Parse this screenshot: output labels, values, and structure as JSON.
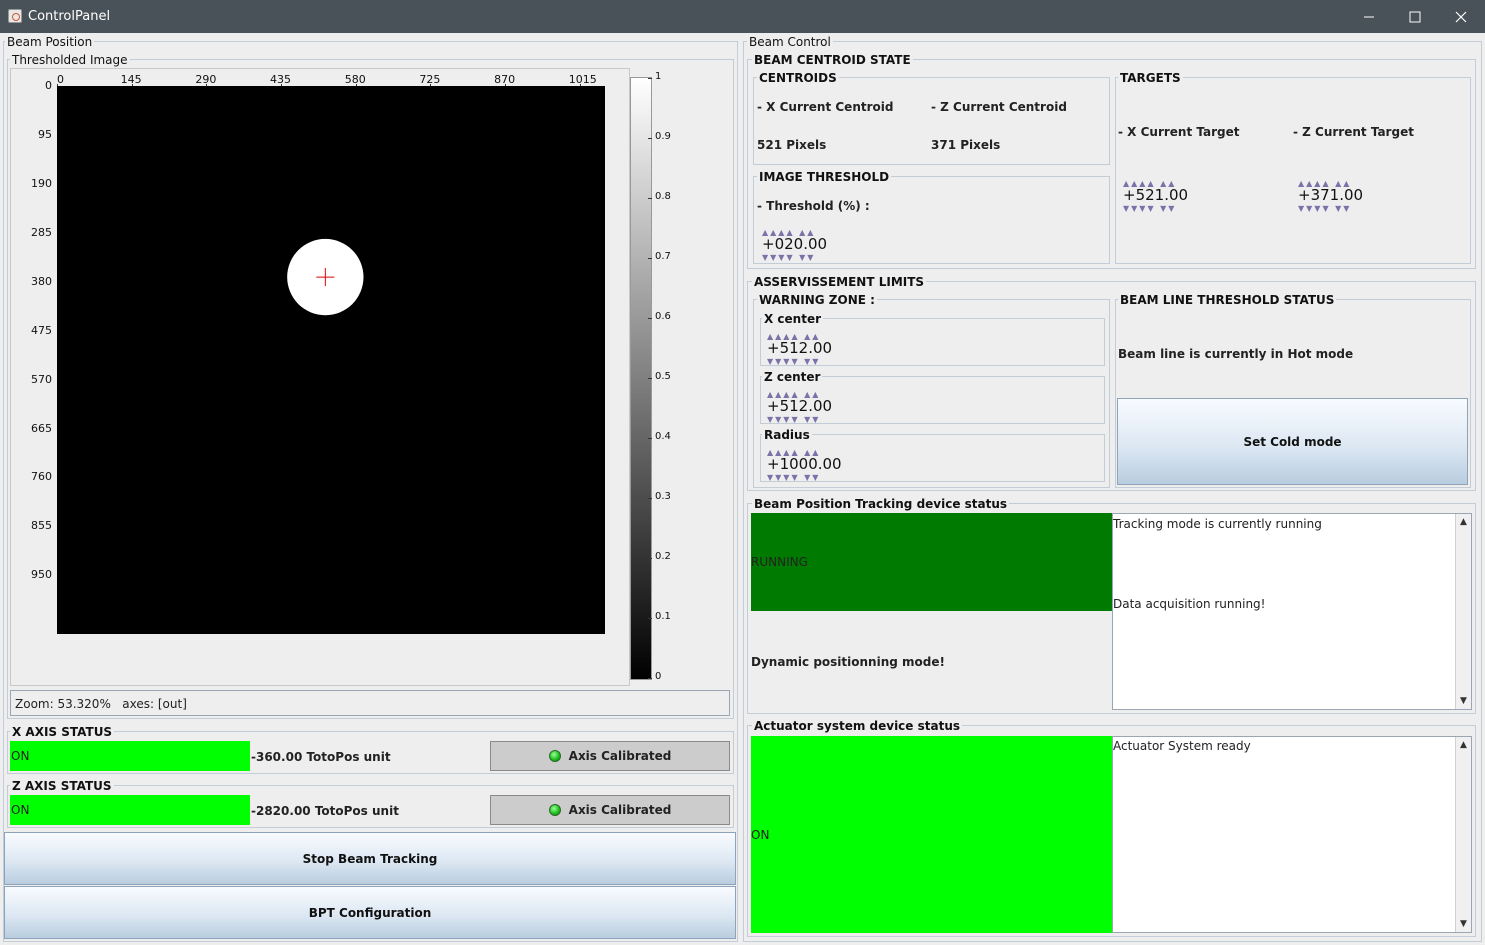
{
  "window": {
    "title": "ControlPanel",
    "minimize": "—",
    "maximize": "☐",
    "close": "✕"
  },
  "left": {
    "title": "Beam Position",
    "image_panel": {
      "title": "Thresholded Image",
      "x_ticks": [
        "0",
        "145",
        "290",
        "435",
        "580",
        "725",
        "870",
        "1015"
      ],
      "y_ticks": [
        "0",
        "95",
        "190",
        "285",
        "380",
        "475",
        "570",
        "665",
        "760",
        "855",
        "950"
      ],
      "colorbar_ticks": [
        "1",
        "0.9",
        "0.8",
        "0.7",
        "0.6",
        "0.5",
        "0.4",
        "0.3",
        "0.2",
        "0.1",
        "0"
      ],
      "beam_spot": {
        "x": 521,
        "y": 371,
        "radius": 95
      },
      "zoom_text": "Zoom: 53.320%   axes: [out]"
    },
    "x_axis": {
      "title": "X AXIS STATUS",
      "state": "ON",
      "position": "-360.00 TotoPos unit",
      "calibrated_label": "Axis Calibrated"
    },
    "z_axis": {
      "title": "Z AXIS STATUS",
      "state": "ON",
      "position": "-2820.00 TotoPos unit",
      "calibrated_label": "Axis Calibrated"
    },
    "stop_button": "Stop Beam Tracking",
    "config_button": "BPT Configuration"
  },
  "right": {
    "title": "Beam Control",
    "centroid_state": {
      "title": "BEAM CENTROID STATE",
      "centroids": {
        "title": "CENTROIDS",
        "x_label": "- X Current Centroid",
        "z_label": "- Z Current Centroid",
        "x_value": "521 Pixels",
        "z_value": "371 Pixels"
      },
      "threshold": {
        "title": "IMAGE THRESHOLD",
        "label": "- Threshold (%) :",
        "value": "+020.00"
      },
      "targets": {
        "title": "TARGETS",
        "x_label": "- X Current Target",
        "z_label": "- Z Current Target",
        "x_value": "+521.00",
        "z_value": "+371.00"
      }
    },
    "limits": {
      "title": "ASSERVISSEMENT LIMITS",
      "warning": {
        "title": "WARNING ZONE :",
        "x_center_label": "X center",
        "x_center_value": "+512.00",
        "z_center_label": "Z center",
        "z_center_value": "+512.00",
        "radius_label": "Radius",
        "radius_value": "+1000.00"
      },
      "beamline": {
        "title": "BEAM LINE THRESHOLD STATUS",
        "status_text": "Beam line is currently in Hot mode",
        "button": "Set Cold mode"
      }
    },
    "tracking": {
      "title": "Beam Position Tracking device status",
      "state": "RUNNING",
      "mode": "Dynamic positionning mode!",
      "log": [
        "Tracking mode is currently running",
        "Data acquisition running!"
      ]
    },
    "actuator": {
      "title": "Actuator system device status",
      "state": "ON",
      "log": [
        "Actuator System ready"
      ]
    }
  },
  "colors": {
    "on_green": "#00ff00",
    "running_green": "#007a00",
    "titlebar": "#4a5259"
  }
}
